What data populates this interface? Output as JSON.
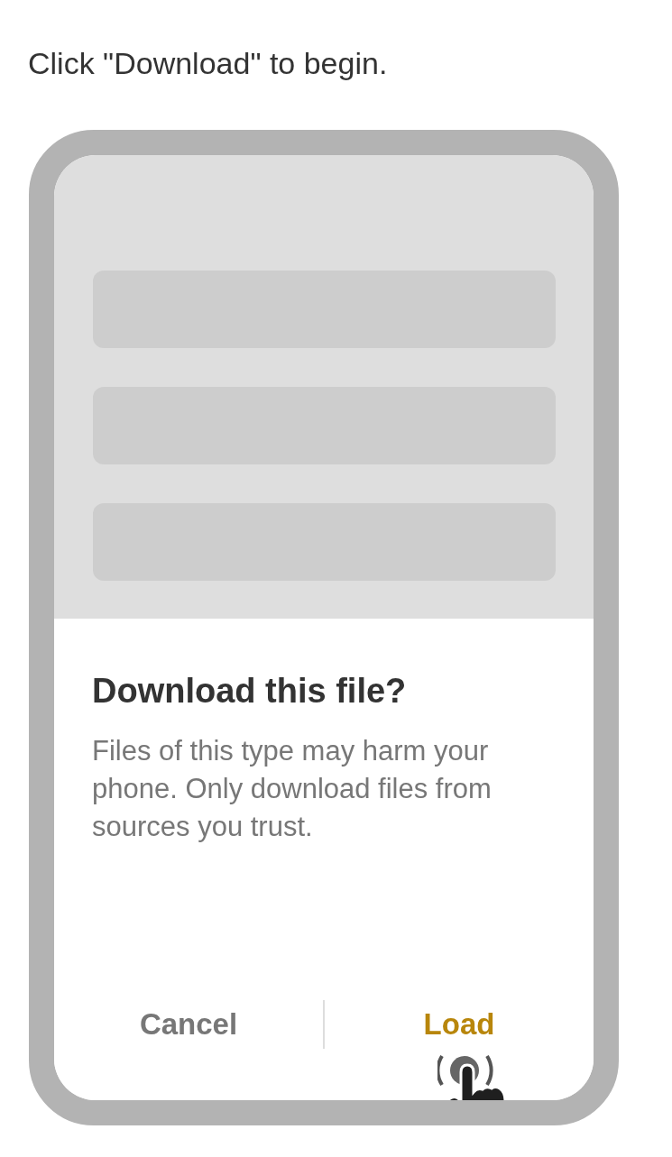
{
  "instruction": "Click \"Download\" to begin.",
  "dialog": {
    "title": "Download this file?",
    "message": "Files of this type may harm your phone. Only download files from sources you trust.",
    "buttons": [
      {
        "label": "Cancel",
        "highlighted": false
      },
      {
        "label": "Load",
        "highlighted": true
      }
    ]
  }
}
